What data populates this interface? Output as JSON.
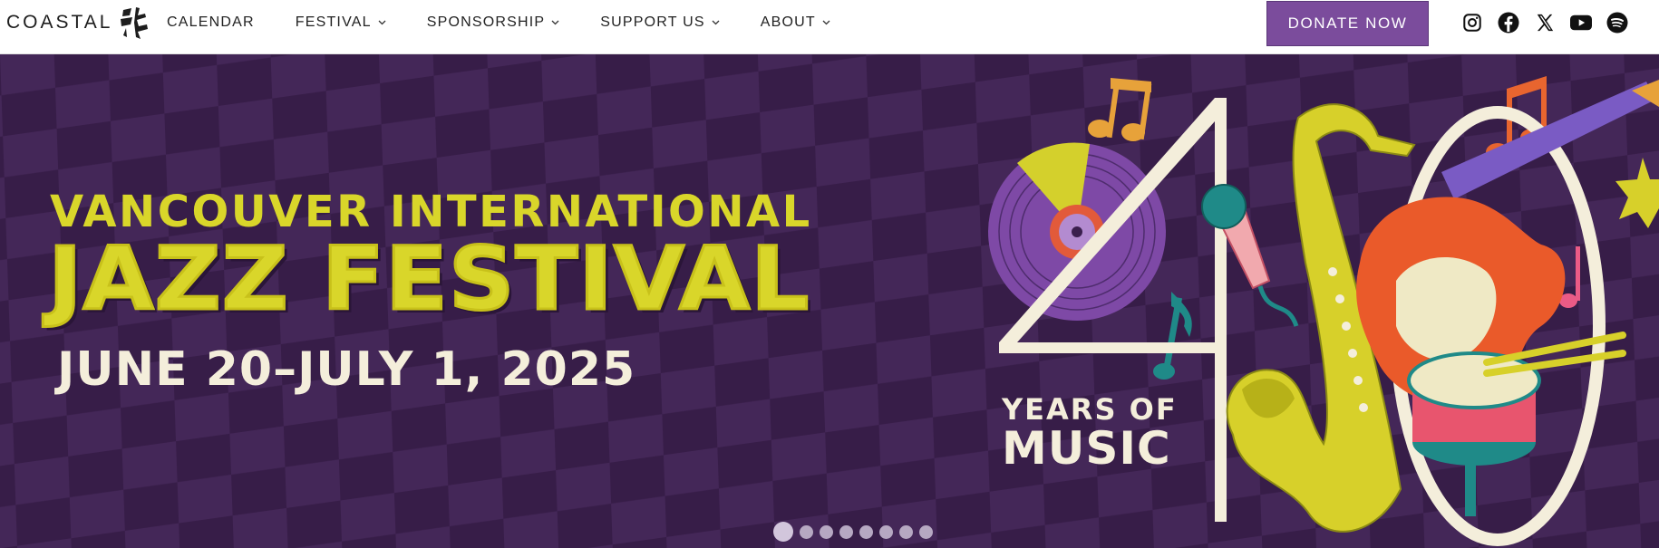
{
  "brand": {
    "name": "COASTAL",
    "logo_icon": "calligraphy-mark-icon"
  },
  "nav": {
    "items": [
      {
        "label": "CALENDAR",
        "has_dropdown": false
      },
      {
        "label": "FESTIVAL",
        "has_dropdown": true
      },
      {
        "label": "SPONSORSHIP",
        "has_dropdown": true
      },
      {
        "label": "SUPPORT US",
        "has_dropdown": true
      },
      {
        "label": "ABOUT",
        "has_dropdown": true
      }
    ]
  },
  "donate_button": {
    "label": "DONATE NOW",
    "color": "#7b4c9c"
  },
  "social_icons": [
    "instagram-icon",
    "facebook-icon",
    "x-icon",
    "youtube-icon",
    "spotify-icon"
  ],
  "hero": {
    "line1": "VANCOUVER INTERNATIONAL",
    "line2": "JAZZ FESTIVAL",
    "line3": "JUNE 20–JULY 1, 2025",
    "years_line1": "YEARS OF",
    "years_line2": "MUSIC",
    "colors": {
      "background": "#3e2150",
      "accent_yellow": "#d9d62a",
      "cream": "#f4eedb"
    }
  },
  "carousel": {
    "slide_count": 8,
    "active_index": 0
  }
}
